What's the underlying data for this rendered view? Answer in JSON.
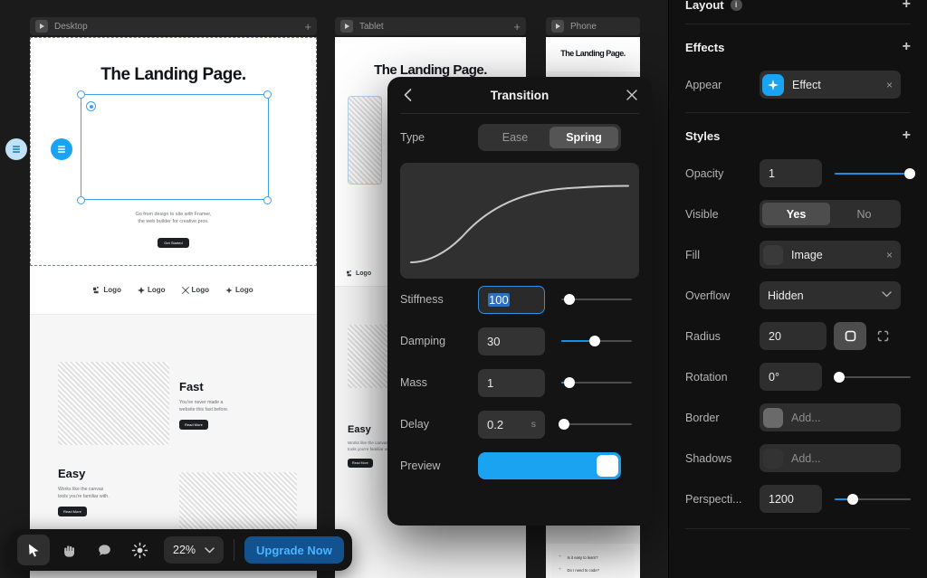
{
  "canvas": {
    "artboards": [
      {
        "name": "Desktop",
        "icon": "play-icon",
        "add": "+"
      },
      {
        "name": "Tablet",
        "icon": "play-icon",
        "add": "+"
      },
      {
        "name": "Phone",
        "icon": "play-icon",
        "add": ""
      }
    ],
    "page": {
      "hero_title": "The Landing Page.",
      "hero_sub_line1": "Go from design to site with Framer,",
      "hero_sub_line2": "the web builder for creative pros.",
      "hero_cta": "Get Started",
      "logos": [
        "Logo",
        "Logo",
        "Logo",
        "Logo"
      ],
      "features": [
        {
          "title": "Fast",
          "line1": "You've never made a",
          "line2": "website this fast before.",
          "cta": "Read More"
        },
        {
          "title": "Easy",
          "line1": "Works like the canvas",
          "line2": "tools you're familiar with.",
          "cta": "Read More"
        }
      ],
      "faq": [
        "Is it easy to learn?",
        "Do I need to code?"
      ]
    },
    "selection_accent": "#3fa0ef"
  },
  "transition": {
    "title": "Transition",
    "back_icon": "chevron-left-icon",
    "close_icon": "close-icon",
    "type_label": "Type",
    "type_options": [
      "Ease",
      "Spring"
    ],
    "type_selected": "Spring",
    "fields": [
      {
        "label": "Stiffness",
        "value": "100",
        "unit": "",
        "focused": true,
        "slider_pct": 12,
        "fill_pct": 0
      },
      {
        "label": "Damping",
        "value": "30",
        "unit": "",
        "focused": false,
        "slider_pct": 48,
        "fill_pct": 48
      },
      {
        "label": "Mass",
        "value": "1",
        "unit": "",
        "focused": false,
        "slider_pct": 12,
        "fill_pct": 9
      },
      {
        "label": "Delay",
        "value": "0.2",
        "unit": "s",
        "focused": false,
        "slider_pct": 4,
        "fill_pct": 0
      }
    ],
    "preview_label": "Preview",
    "preview_on": true,
    "accent": "#1aa3f0"
  },
  "right_panel": {
    "layout": {
      "label": "Layout",
      "info_icon": "info-icon",
      "add": "+"
    },
    "effects": {
      "label": "Effects",
      "add": "+",
      "rows": [
        {
          "label": "Appear",
          "chip": "Effect",
          "icon": "sparkle-icon",
          "remove": "×"
        }
      ]
    },
    "styles": {
      "label": "Styles",
      "add": "+",
      "opacity": {
        "label": "Opacity",
        "value": "1",
        "slider_pct": 100
      },
      "visible": {
        "label": "Visible",
        "options": [
          "Yes",
          "No"
        ],
        "selected": "Yes"
      },
      "fill": {
        "label": "Fill",
        "value": "Image",
        "remove": "×",
        "swatch": "#3a3a3a"
      },
      "overflow": {
        "label": "Overflow",
        "value": "Hidden",
        "caret": "chevron-down-icon"
      },
      "radius": {
        "label": "Radius",
        "value": "20",
        "modes": [
          "radius-uniform-icon",
          "radius-individual-icon"
        ],
        "selected_mode": 0
      },
      "rotation": {
        "label": "Rotation",
        "value": "0°",
        "slider_pct": 5
      },
      "border": {
        "label": "Border",
        "value": "Add...",
        "swatch": "#6a6a6a"
      },
      "shadows": {
        "label": "Shadows",
        "value": "Add...",
        "swatch": "#333333"
      },
      "perspective": {
        "label": "Perspecti...",
        "value": "1200",
        "slider_pct": 24
      }
    }
  },
  "toolbar": {
    "tools": [
      {
        "name": "cursor-tool",
        "icon": "cursor-icon",
        "active": true
      },
      {
        "name": "hand-tool",
        "icon": "hand-icon",
        "active": false
      },
      {
        "name": "comment-tool",
        "icon": "comment-icon",
        "active": false
      },
      {
        "name": "insert-tool",
        "icon": "sun-icon",
        "active": false
      }
    ],
    "zoom_value": "22%",
    "zoom_caret": "chevron-down-icon",
    "upgrade_label": "Upgrade Now"
  }
}
